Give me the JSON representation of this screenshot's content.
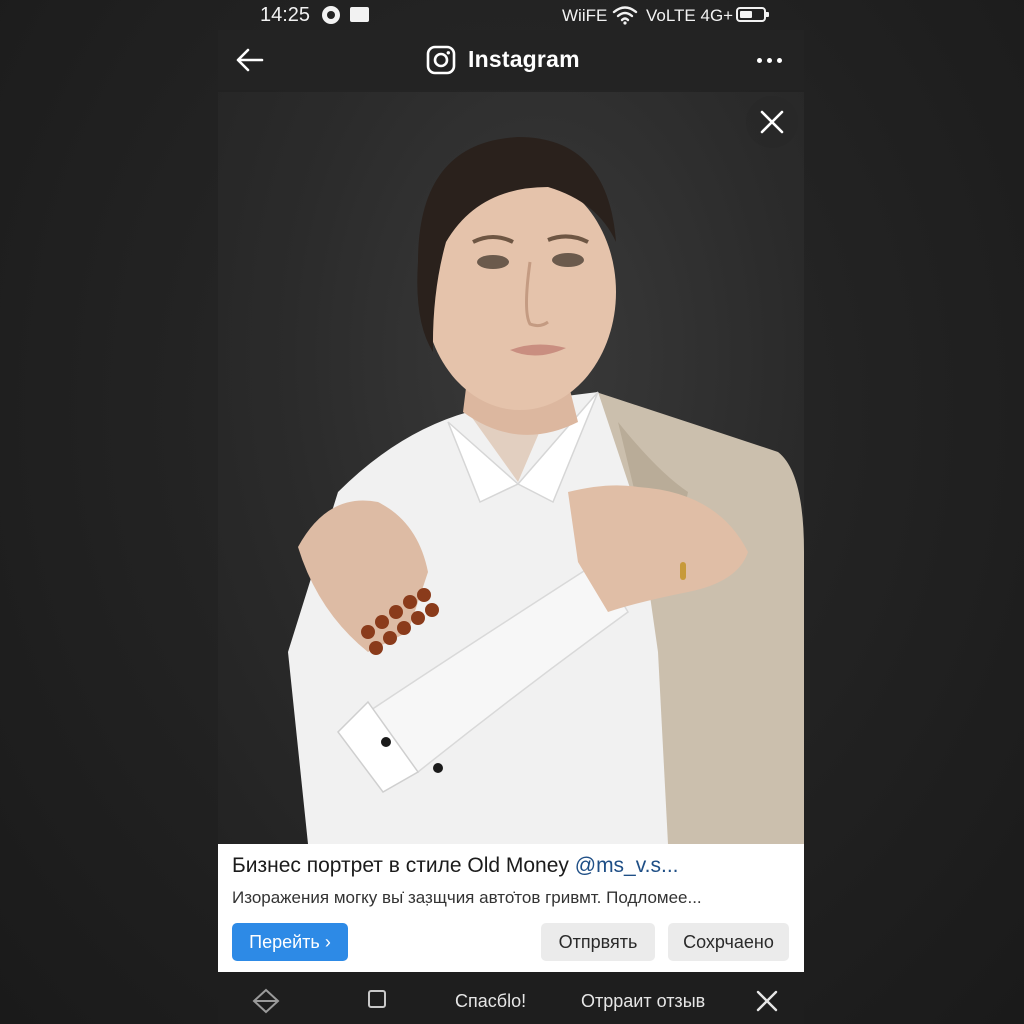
{
  "status_bar": {
    "time": "14:25",
    "wifi_label": "WiiFE",
    "network": "VoLTE 4G+"
  },
  "header": {
    "title": "Instagram",
    "back_icon": "arrow-left-icon",
    "more_icon": "more-dots-icon",
    "logo_icon": "instagram-logo-icon"
  },
  "photo": {
    "close_icon": "close-icon"
  },
  "caption": {
    "title": "Бизнес портрет в стиле Old Money",
    "handle": "@ms_v.s...",
    "text": "Изоражения могку вы̇ заз̣щчия авто̇тов гривмт. Подломее...",
    "primary_button": "Перейть",
    "send_button": "Отпрвять",
    "saved_button": "Сохрчаено"
  },
  "bottom_bar": {
    "thanks": "Спасбlo!",
    "feedback": "Отрраит отзыв"
  },
  "colors": {
    "background": "#232323",
    "accent": "#2d8ae6",
    "handle": "#1f4f86",
    "card": "#ffffff"
  }
}
